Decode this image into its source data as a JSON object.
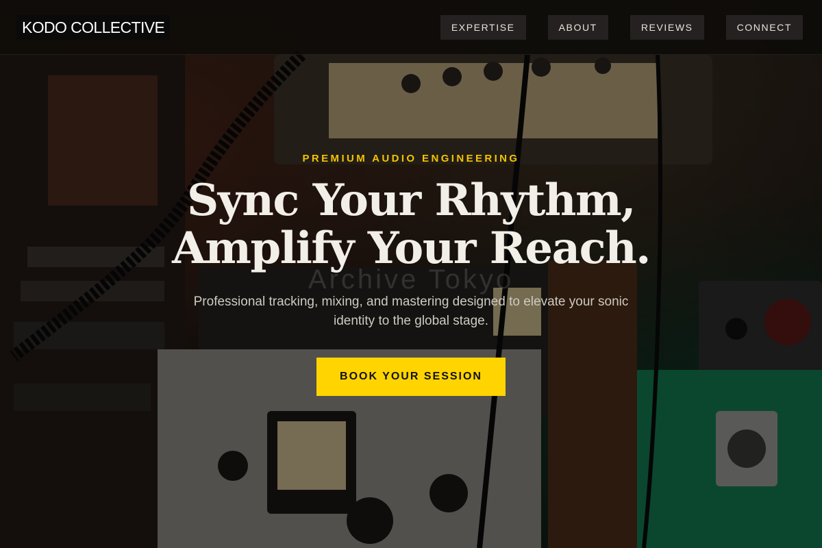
{
  "header": {
    "logo": "KODO COLLECTIVE",
    "nav": [
      {
        "label": "EXPERTISE"
      },
      {
        "label": "ABOUT"
      },
      {
        "label": "REVIEWS"
      },
      {
        "label": "CONNECT"
      }
    ]
  },
  "hero": {
    "eyebrow": "PREMIUM AUDIO ENGINEERING",
    "headline_line1": "Sync Your Rhythm,",
    "headline_line2": "Amplify Your Reach.",
    "subtitle": "Professional tracking, mixing, and mastering designed to elevate your sonic identity to the global stage.",
    "cta_label": "BOOK YOUR SESSION",
    "background_watermark": "Archive Tokyo",
    "background_image": "studio-outboard-gear-photo"
  },
  "colors": {
    "accent": "#ffd400",
    "eyebrow": "#f5c400",
    "header_bg": "#0c0a08",
    "text_light": "#f2eee8"
  }
}
